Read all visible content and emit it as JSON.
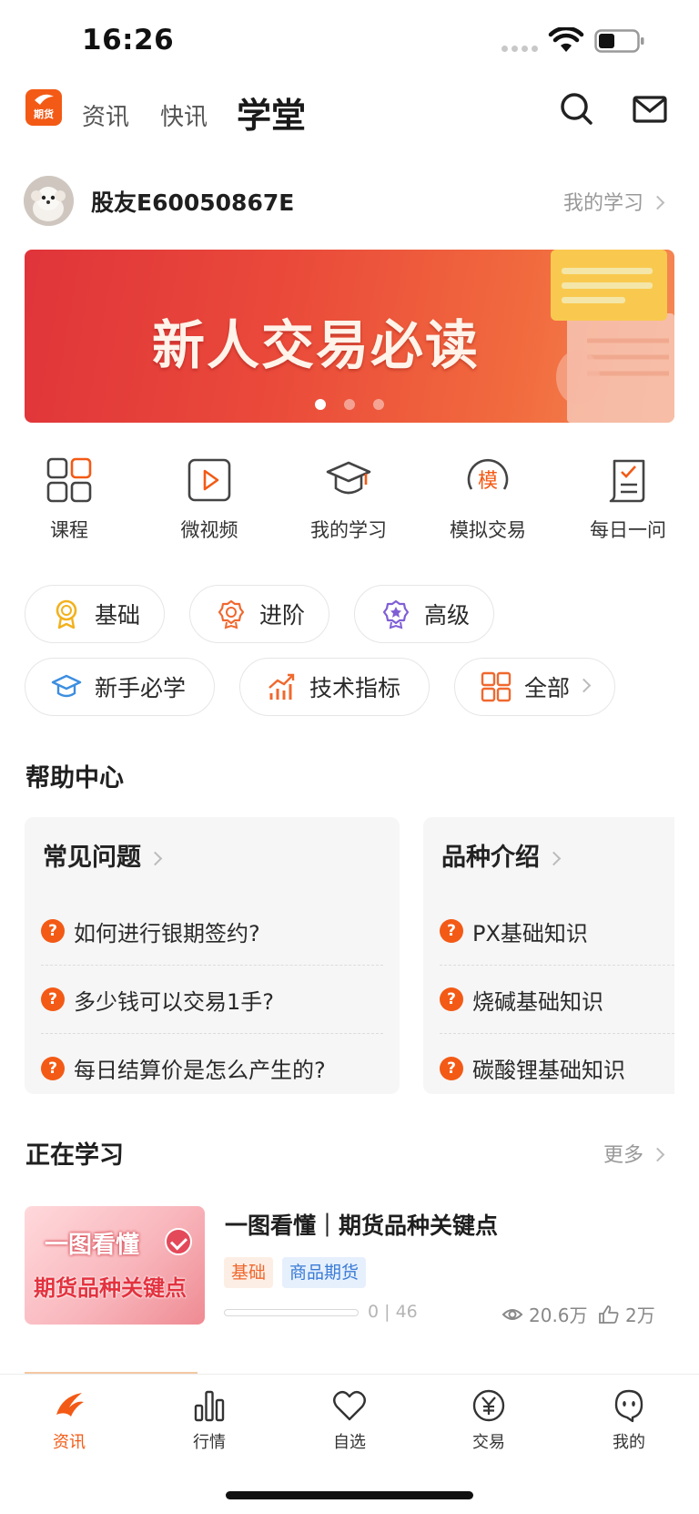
{
  "status_bar": {
    "time": "16:26"
  },
  "header": {
    "logo_text": "期货",
    "tabs": [
      {
        "label": "资讯",
        "active": false
      },
      {
        "label": "快讯",
        "active": false
      },
      {
        "label": "学堂",
        "active": true
      }
    ],
    "icons": [
      "search-icon",
      "mail-icon"
    ]
  },
  "user": {
    "name": "股友E60050867E",
    "my_study_link": "我的学习"
  },
  "banner": {
    "title": "新人交易必读",
    "dots": 3,
    "active_dot": 1
  },
  "quick_entries": [
    {
      "label": "课程",
      "icon": "grid-icon"
    },
    {
      "label": "微视频",
      "icon": "video-play-icon"
    },
    {
      "label": "我的学习",
      "icon": "graduation-cap-icon"
    },
    {
      "label": "模拟交易",
      "icon": "simulate-badge-icon"
    },
    {
      "label": "每日一问",
      "icon": "daily-question-icon"
    }
  ],
  "chips_row1": [
    {
      "label": "基础",
      "icon": "medal-icon"
    },
    {
      "label": "进阶",
      "icon": "badge-icon"
    },
    {
      "label": "高级",
      "icon": "star-badge-icon"
    }
  ],
  "chips_row2": [
    {
      "label": "新手必学",
      "icon": "graduation-cap-icon"
    },
    {
      "label": "技术指标",
      "icon": "trend-chart-icon"
    },
    {
      "label": "全部",
      "icon": "grid-icon"
    }
  ],
  "help_center": {
    "title": "帮助中心",
    "cards": [
      {
        "title": "常见问题",
        "items": [
          "如何进行银期签约?",
          "多少钱可以交易1手?",
          "每日结算价是怎么产生的?"
        ]
      },
      {
        "title": "品种介绍",
        "items": [
          "PX基础知识",
          "烧碱基础知识",
          "碳酸锂基础知识"
        ]
      }
    ],
    "item_badge": "?"
  },
  "learning": {
    "title": "正在学习",
    "more_label": "更多",
    "course": {
      "title": "一图看懂｜期货品种关键点",
      "thumb_line1": "一图看懂",
      "thumb_line2": "期货品种关键点",
      "tags": [
        "基础",
        "商品期货"
      ],
      "progress_text": "0 | 46",
      "progress_fraction": 0,
      "views": "20.6万",
      "likes": "2万"
    }
  },
  "colors": {
    "accent": "#f35a15",
    "banner_red": "#e0343a",
    "tag_blue": "#3a7bd5"
  },
  "tabbar": [
    {
      "label": "资讯",
      "icon": "news-flame-icon",
      "active": true
    },
    {
      "label": "行情",
      "icon": "bar-chart-icon",
      "active": false
    },
    {
      "label": "自选",
      "icon": "heart-icon",
      "active": false
    },
    {
      "label": "交易",
      "icon": "yen-coin-icon",
      "active": false
    },
    {
      "label": "我的",
      "icon": "profile-face-icon",
      "active": false
    }
  ]
}
